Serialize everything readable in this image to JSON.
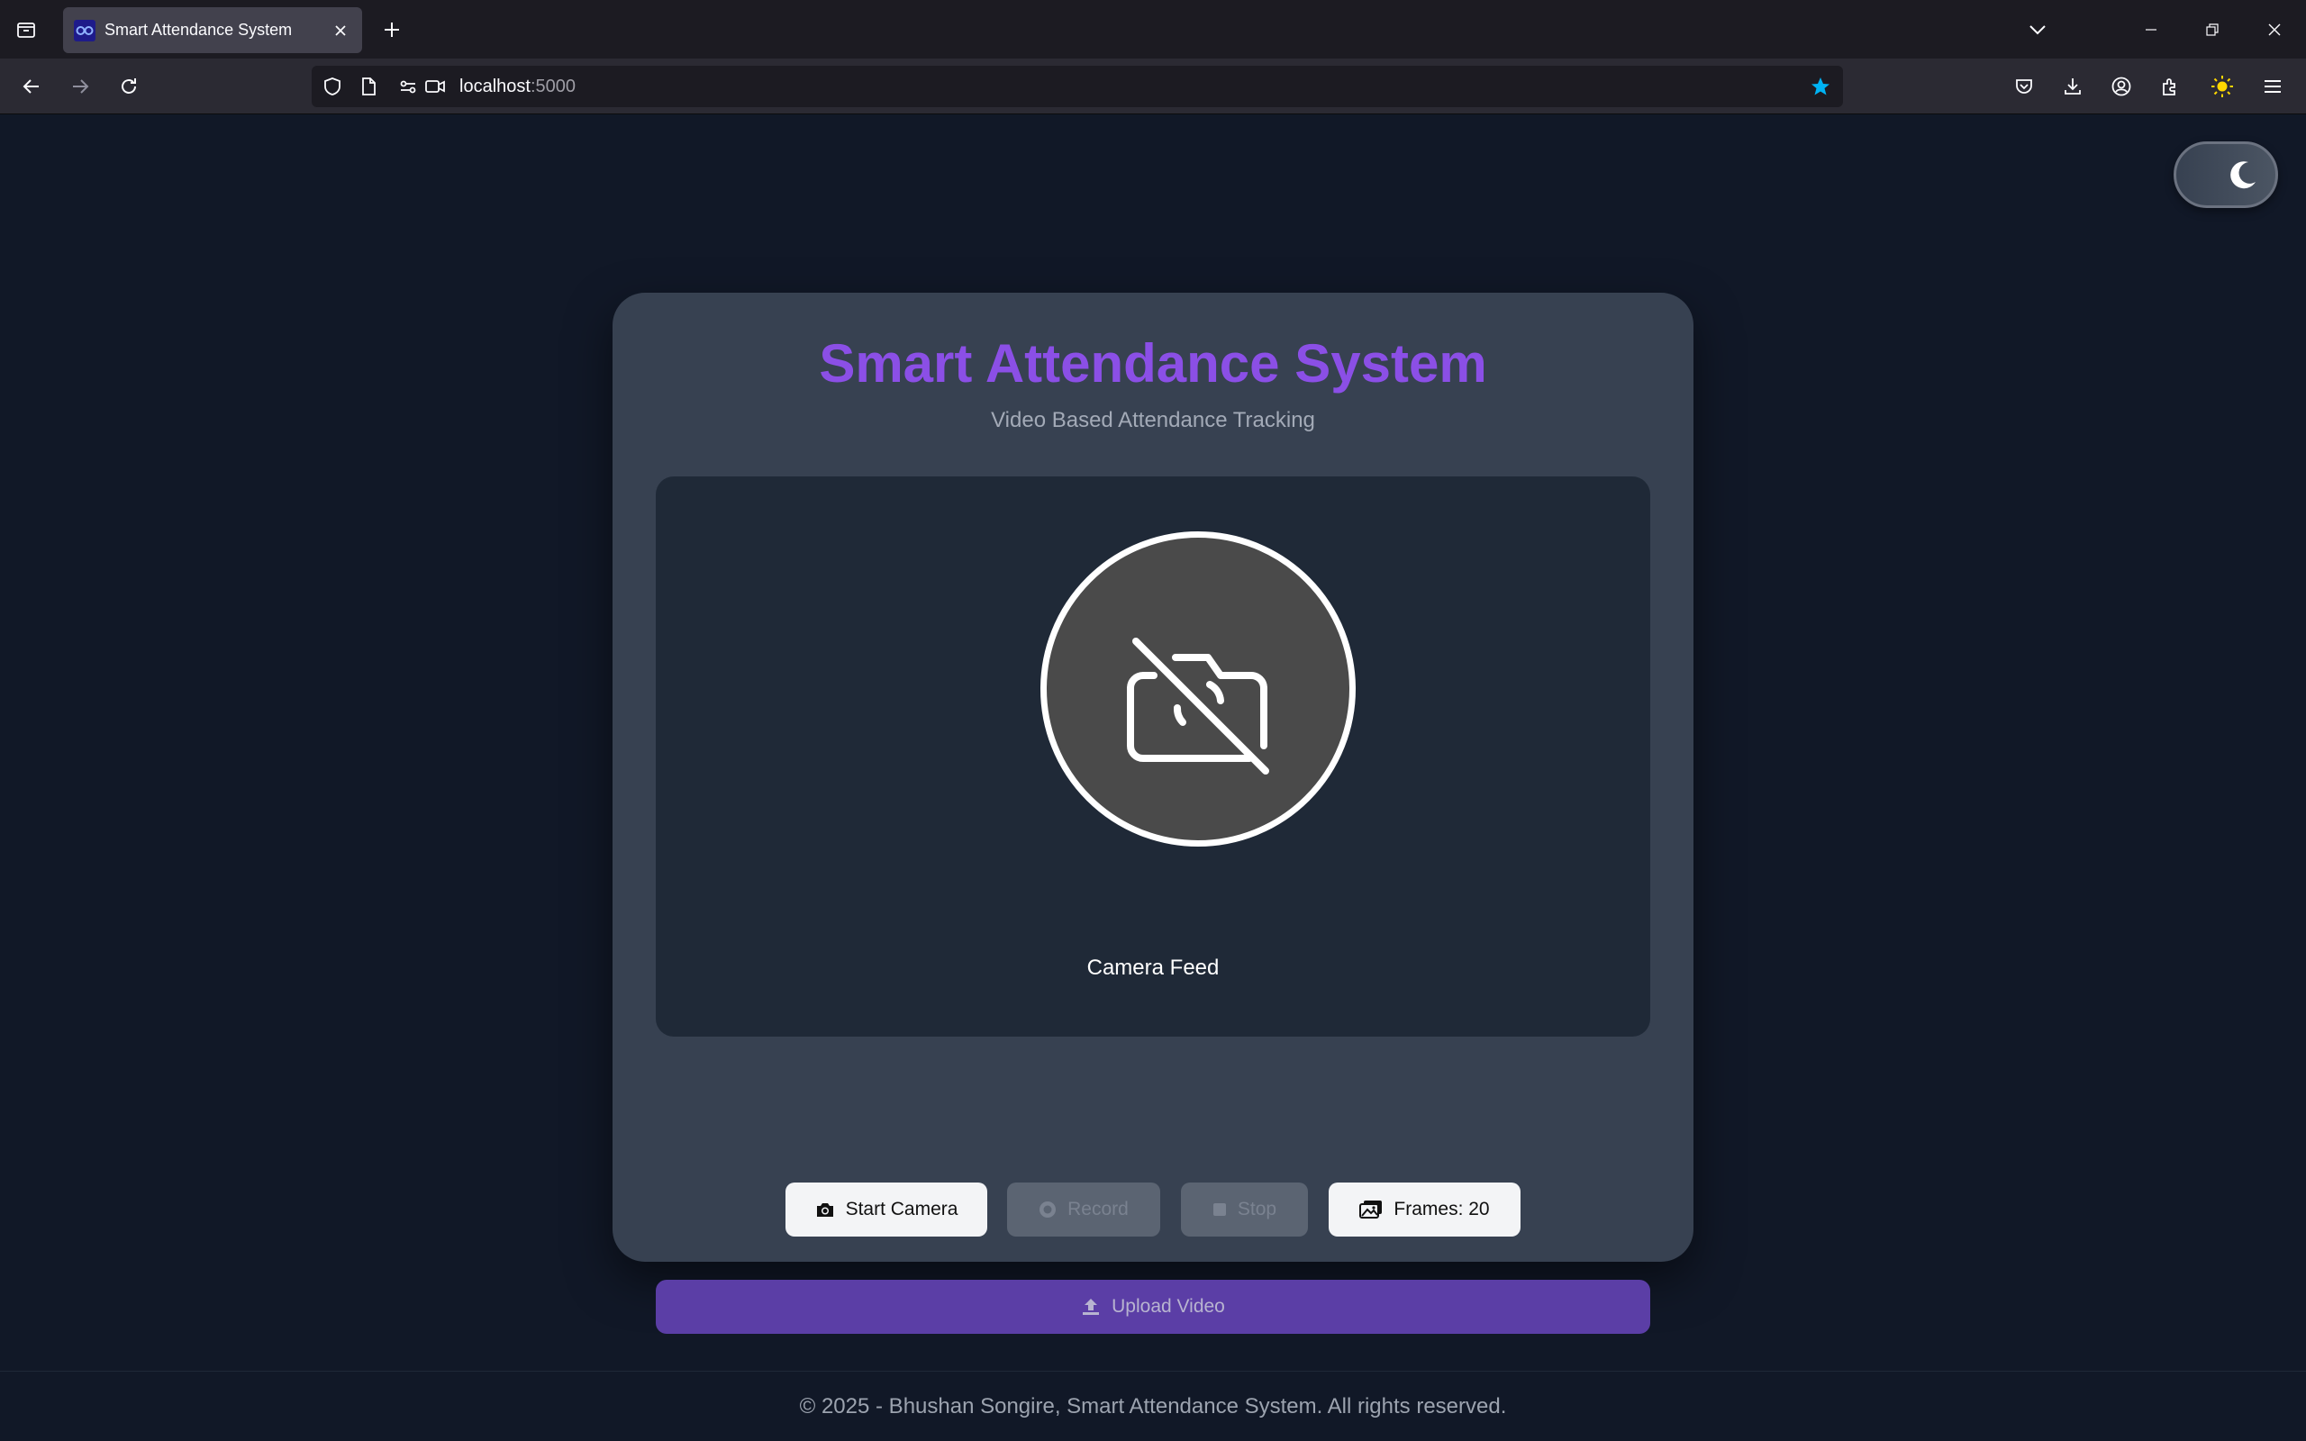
{
  "browser": {
    "tab_title": "Smart Attendance System",
    "url_host": "localhost",
    "url_port": ":5000"
  },
  "header": {
    "title": "Smart Attendance System",
    "subtitle": "Video Based Attendance Tracking"
  },
  "feed": {
    "label": "Camera Feed"
  },
  "controls": {
    "start_camera": "Start Camera",
    "record": "Record",
    "stop": "Stop",
    "frames": "Frames: 20"
  },
  "upload": {
    "label": "Upload Video"
  },
  "footer": {
    "text": "© 2025 - Bhushan Songire, Smart Attendance System. All rights reserved."
  },
  "colors": {
    "accent_title": "#8b4fe6",
    "upload_bg": "#5b3ea6",
    "page_bg": "#111827",
    "card_bg": "#374151"
  },
  "icons": [
    "tab-list-icon",
    "favicon-icon",
    "close-icon",
    "plus-icon",
    "chevron-down-icon",
    "minimize-icon",
    "restore-icon",
    "window-close-icon",
    "back-icon",
    "forward-icon",
    "reload-icon",
    "shield-icon",
    "page-icon",
    "permissions-icon",
    "camera-permission-icon",
    "star-icon",
    "pocket-icon",
    "download-icon",
    "account-icon",
    "extensions-icon",
    "sun-icon",
    "menu-icon",
    "moon-icon",
    "camera-off-icon",
    "camera-icon",
    "record-icon",
    "stop-icon",
    "images-icon",
    "upload-icon"
  ]
}
